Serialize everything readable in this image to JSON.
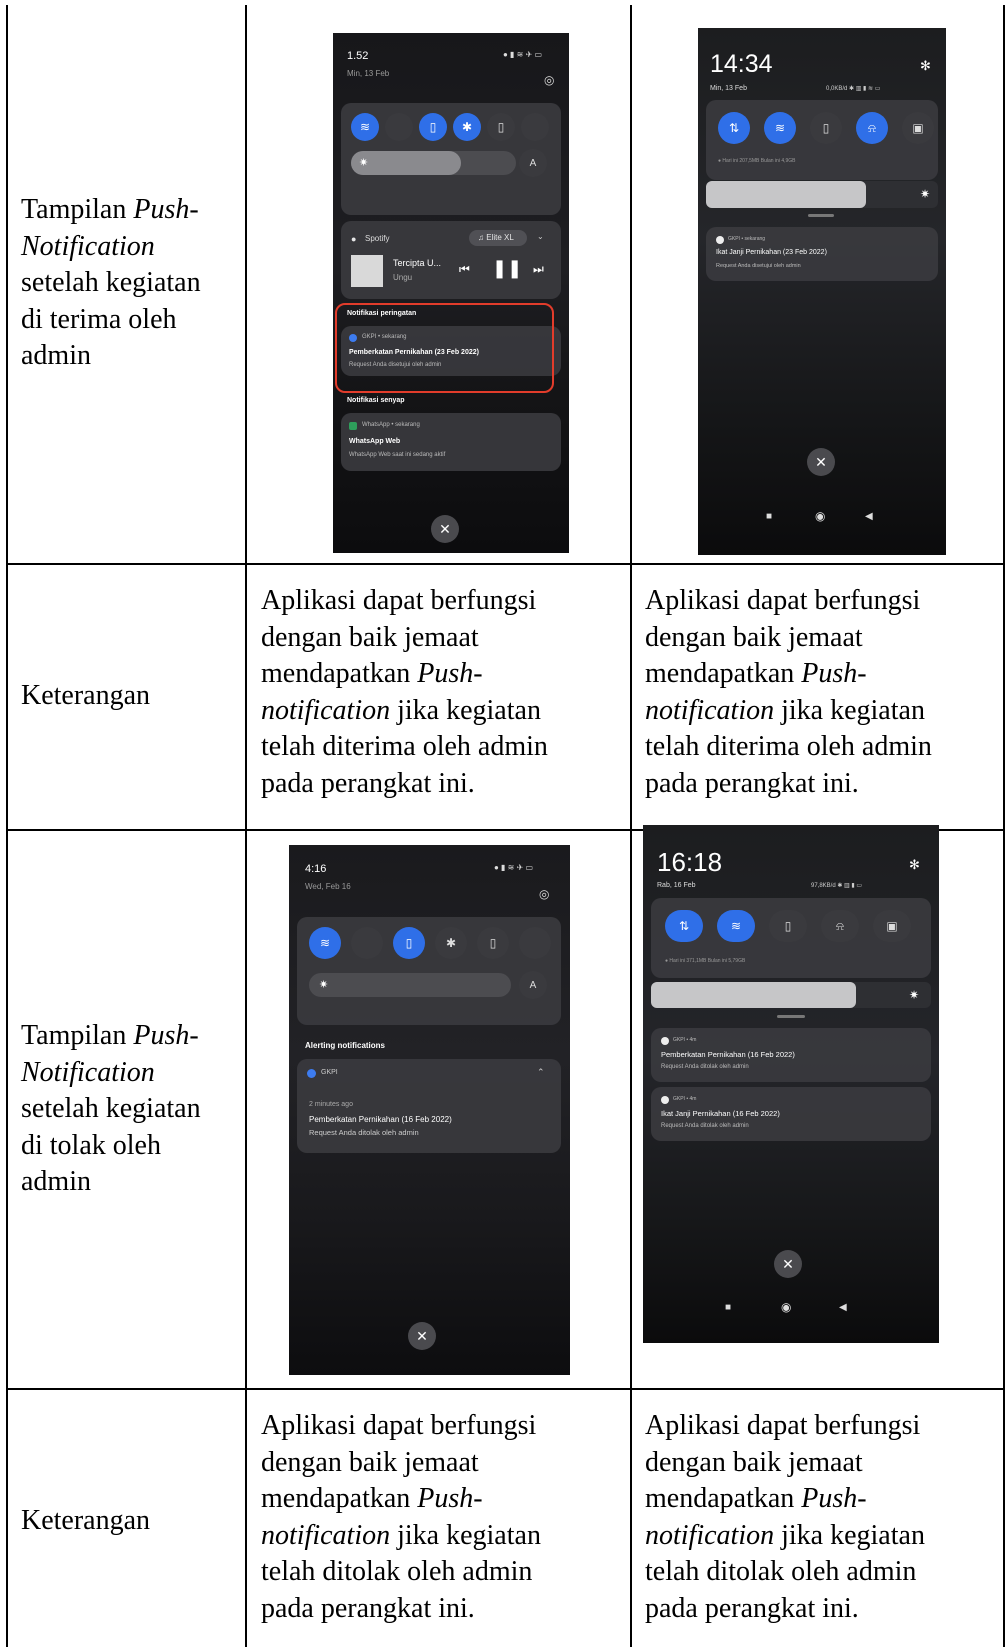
{
  "rows": [
    {
      "label_pre": "Tampilan ",
      "label_italic": "Push-Notification",
      "label_post": " setelah kegiatan di terima oleh admin",
      "label_lines": [
        "Tampilan ",
        "Push-",
        "Notification",
        "setelah kegiatan",
        "di terima oleh",
        "admin"
      ]
    },
    {
      "label": "Keterangan",
      "desc_a": [
        "Aplikasi dapat berfungsi",
        "dengan baik jemaat",
        "mendapatkan ",
        "Push-",
        "notification",
        " jika kegiatan",
        "telah diterima oleh admin",
        "pada perangkat ini."
      ],
      "desc_b": [
        "Aplikasi dapat berfungsi",
        "dengan baik jemaat",
        "mendapatkan ",
        "Push-",
        "notification",
        " jika kegiatan",
        "telah diterima oleh admin",
        "pada perangkat ini."
      ]
    },
    {
      "label_lines": [
        "Tampilan ",
        "Push-",
        "Notification",
        "setelah kegiatan",
        "di tolak oleh",
        "admin"
      ]
    },
    {
      "label": "Keterangan",
      "desc_a": [
        "Aplikasi dapat berfungsi",
        "dengan baik jemaat",
        "mendapatkan ",
        "Push-",
        "notification",
        " jika kegiatan",
        "telah ditolak oleh admin",
        "pada perangkat ini."
      ],
      "desc_b": [
        "Aplikasi dapat berfungsi",
        "dengan baik jemaat",
        "mendapatkan ",
        "Push-",
        "notification",
        " jika kegiatan",
        "telah ditolak oleh admin",
        "pada perangkat ini."
      ]
    }
  ],
  "shot1": {
    "time": "1.52",
    "date": "Min, 13 Feb",
    "media_app": "Spotify",
    "media_output": "Elite XL",
    "song": "Tercipta U...",
    "artist": "Ungu",
    "brightness_auto": "A",
    "section_alert": "Notifikasi peringatan",
    "notif_meta": "GKPI • sekarang",
    "notif_title": "Pemberkatan Pernikahan (23 Feb 2022)",
    "notif_body": "Request Anda disetujui oleh admin",
    "section_silent": "Notifikasi senyap",
    "wa_meta": "WhatsApp • sekarang",
    "wa_title": "WhatsApp Web",
    "wa_body": "WhatsApp Web saat ini sedang aktif"
  },
  "shot2": {
    "time": "14:34",
    "date": "Min, 13 Feb",
    "status": "0,0KB/d",
    "data_usage": "Hari ini 207,5MB    Bulan ini 4,9GB",
    "notif_meta": "GKPI • sekarang",
    "notif_title": "Ikat Janji Pernikahan (23 Feb 2022)",
    "notif_body": "Request Anda disetujui oleh admin"
  },
  "shot3": {
    "time": "4:16",
    "date": "Wed, Feb 16",
    "brightness_auto": "A",
    "section_alert": "Alerting notifications",
    "notif_app": "GKPI",
    "notif_ago": "2 minutes ago",
    "notif_title": "Pemberkatan Pernikahan (16 Feb 2022)",
    "notif_body": "Request Anda ditolak oleh admin"
  },
  "shot4": {
    "time": "16:18",
    "date": "Rab, 16 Feb",
    "status": "97,8KB/d",
    "data_usage": "Hari ini 371,1MB    Bulan ini 5,79GB",
    "n1_meta": "GKPI • 4m",
    "n1_title": "Pemberkatan Pernikahan (16 Feb 2022)",
    "n1_body": "Request Anda ditolak oleh admin",
    "n2_meta": "GKPI • 4m",
    "n2_title": "Ikat Janji Pernikahan (16 Feb 2022)",
    "n2_body": "Request Anda ditolak oleh admin"
  }
}
